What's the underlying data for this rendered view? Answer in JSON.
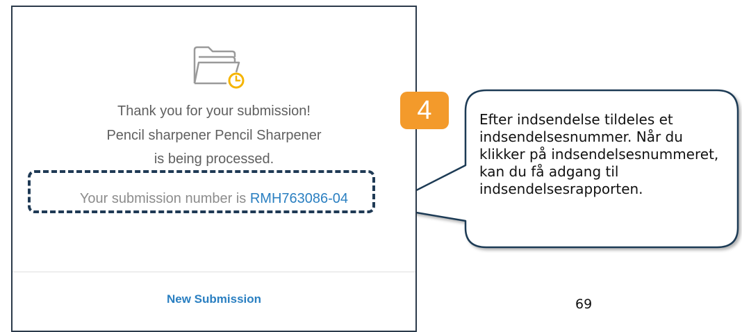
{
  "dialog": {
    "icon": "folder-clock-icon",
    "message_line1": "Thank you for your submission!",
    "message_line2": "Pencil sharpener Pencil Sharpener",
    "message_line3": "is being processed.",
    "submission_prefix": "Your submission number is ",
    "submission_number": "RMH763086-04",
    "new_submission_label": "New Submission",
    "link_color": "#2a7fc1",
    "icon_accent_color": "#f5b400"
  },
  "annotation": {
    "step_number": "4",
    "step_badge_color": "#f39a2b",
    "callout_text": "Efter indsendelse tildeles et indsendelsesnummer. Når du klikker på indsendelsesnummeret, kan du få adgang til indsendelsesrapporten."
  },
  "page": {
    "number": "69"
  }
}
